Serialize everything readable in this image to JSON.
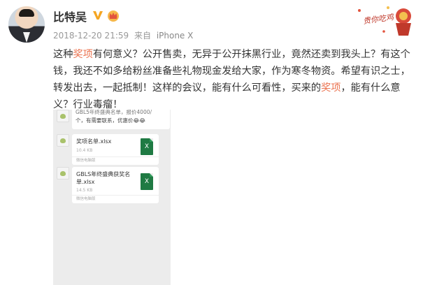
{
  "user": {
    "name": "比特吴",
    "verified_badge_icon": "v-verified-icon",
    "member_badge_icon": "crown-icon"
  },
  "meta": {
    "timestamp": "2018-12-20 21:59",
    "source_prefix": "来自",
    "device": "iPhone X"
  },
  "sticker": {
    "text": "贵你吃鸡"
  },
  "post": {
    "segments": [
      {
        "text": "这种",
        "kw": false
      },
      {
        "text": "奖项",
        "kw": true
      },
      {
        "text": "有何意义？公开售卖，无异于公开抹黑行业，竟然还卖到我头上？有这个钱，我还不如多给粉丝准备些礼物现金发给大家，作为寒冬物资。希望有识之士，转发出去，一起抵制！这样的会议，能有什么可看性，买来的",
        "kw": false
      },
      {
        "text": "奖项",
        "kw": true
      },
      {
        "text": "，能有什么意义？行业毒瘤！",
        "kw": false
      }
    ]
  },
  "screenshot": {
    "message_partial_line1": "GBL5年终盛典名单，报价4000/",
    "message_partial_line2": "个，有需要联系，优惠价😂😂",
    "file1": {
      "name": "奖项名单.xlsx",
      "size": "10.4 KB",
      "type_icon": "X"
    },
    "file2": {
      "name": "GBLS年终盛典获奖名单.xlsx",
      "size": "14.5 KB",
      "type_icon": "X"
    },
    "file_footer": "微信电脑版"
  },
  "colors": {
    "keyword": "#eb7350",
    "verified": "#f5a623",
    "excel": "#1f7a43"
  }
}
